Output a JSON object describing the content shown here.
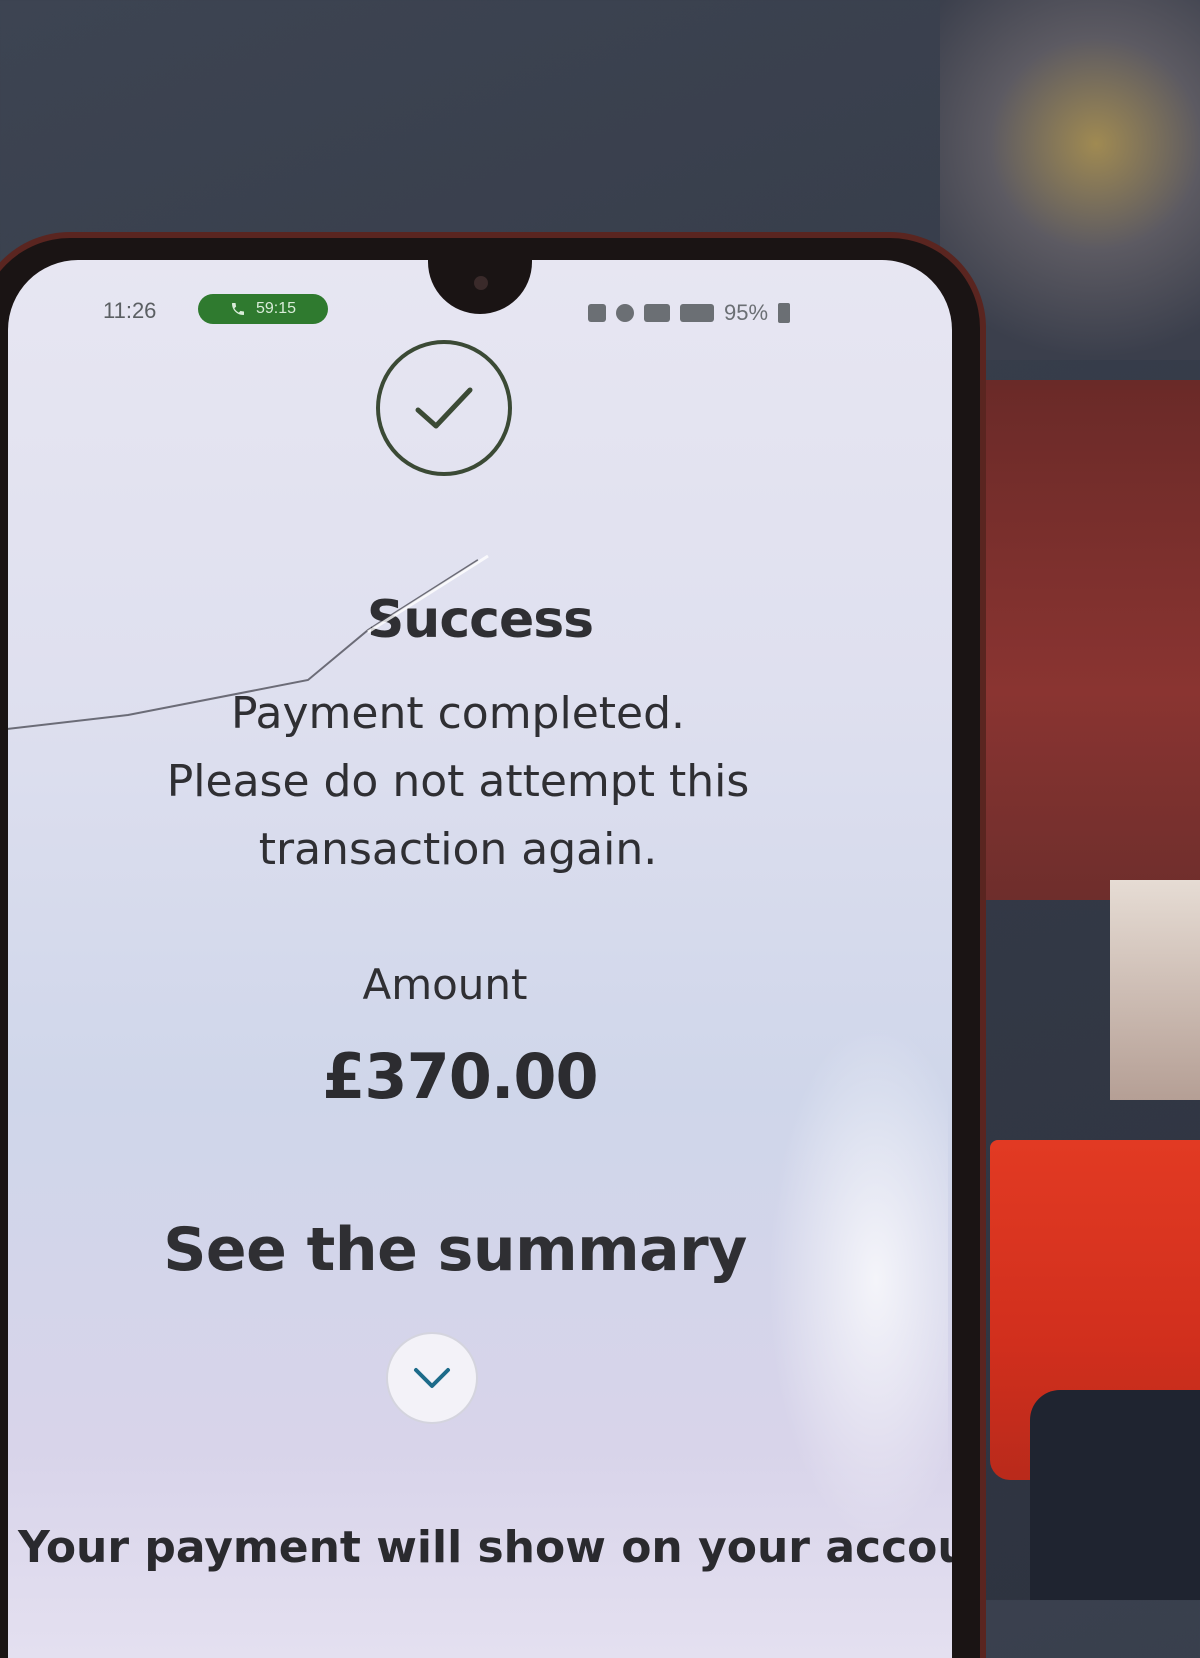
{
  "status_bar": {
    "time": "11:26",
    "call_timer": "59:15",
    "battery": "95%"
  },
  "result": {
    "title": "Success",
    "message_line1": "Payment completed.",
    "message_line2": "Please do not attempt this",
    "message_line3": "transaction again."
  },
  "amount": {
    "label": "Amount",
    "value": "£370.00"
  },
  "summary": {
    "title": "See the summary"
  },
  "footer": {
    "text": "Your payment will show on your account"
  },
  "colors": {
    "call_pill": "#2f7a2f",
    "check_ring": "#3b4a35",
    "chevron": "#1d6b8a"
  },
  "icons": [
    "phone-icon",
    "checkmark-icon",
    "chevron-down-icon",
    "battery-icon"
  ]
}
